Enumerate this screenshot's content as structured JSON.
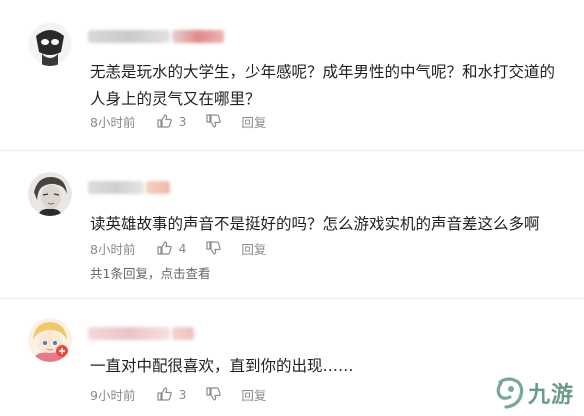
{
  "comments": [
    {
      "text": "无恙是玩水的大学生，少年感呢？成年男性的中气呢？和水打交道的人身上的灵气又在哪里？",
      "time": "8小时前",
      "likes": "3",
      "reply_label": "回复"
    },
    {
      "text": "读英雄故事的声音不是挺好的吗？怎么游戏实机的声音差这么多啊",
      "time": "8小时前",
      "likes": "4",
      "reply_label": "回复",
      "replies_summary": "共1条回复，点击查看"
    },
    {
      "text": "一直对中配很喜欢，直到你的出现……",
      "time": "9小时前",
      "likes": "3",
      "reply_label": "回复"
    }
  ],
  "watermark": {
    "text": "九游"
  },
  "icons": {
    "like": "thumbs-up-icon",
    "dislike": "thumbs-down-icon",
    "watermark": "nine-game-logo-icon"
  },
  "colors": {
    "meta": "#8a8a8a",
    "watermark": "#6a9a8d"
  }
}
